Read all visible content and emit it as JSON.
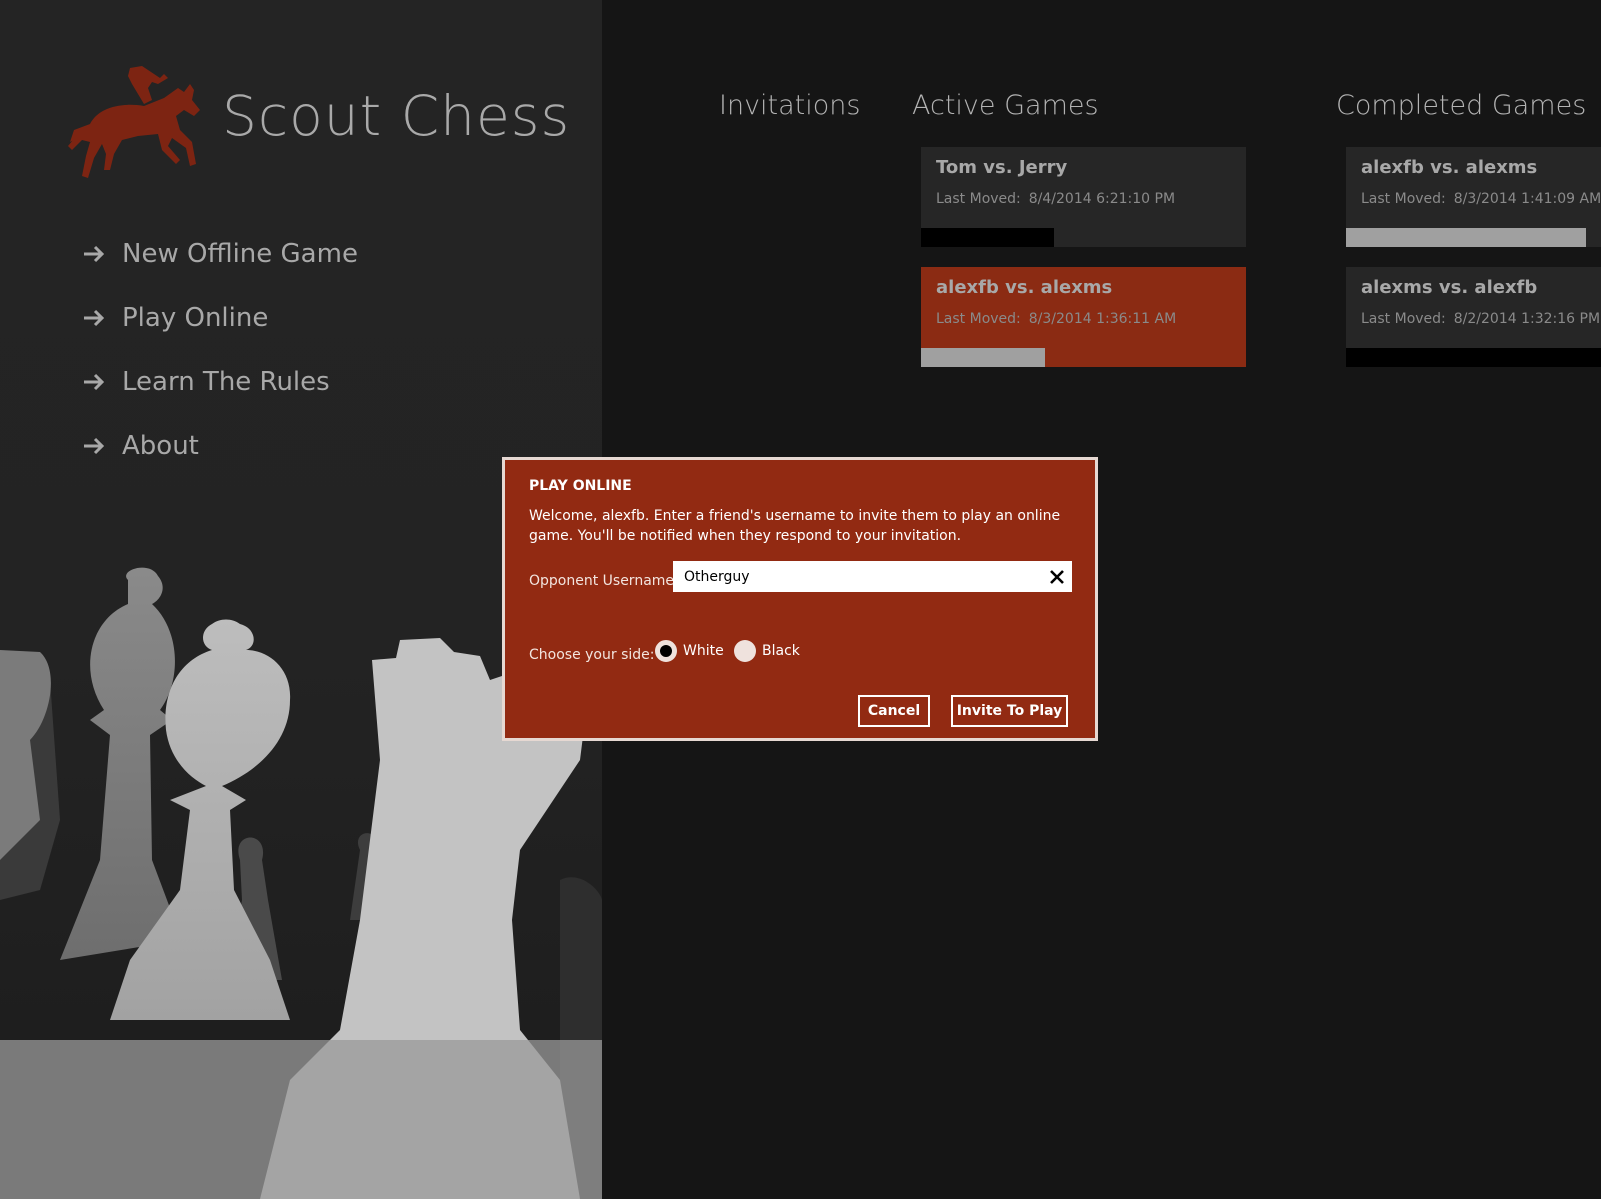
{
  "app": {
    "title": "Scout Chess"
  },
  "nav": [
    {
      "label": "New Offline Game"
    },
    {
      "label": "Play Online"
    },
    {
      "label": "Learn The Rules"
    },
    {
      "label": "About"
    }
  ],
  "columns": {
    "invitations": {
      "header": "Invitations"
    },
    "active": {
      "header": "Active Games",
      "games": [
        {
          "title": "Tom vs. Jerry",
          "last_moved_label": "Last Moved:",
          "last_moved": "8/4/2014 6:21:10 PM",
          "progress": 0.41,
          "bar_color": "#000000"
        },
        {
          "title": "alexfb vs. alexms",
          "last_moved_label": "Last Moved:",
          "last_moved": "8/3/2014 1:36:11 AM",
          "progress": 0.38,
          "bar_color": "#a0a0a0"
        }
      ]
    },
    "completed": {
      "header": "Completed Games",
      "games": [
        {
          "title": "alexfb vs. alexms",
          "last_moved_label": "Last Moved:",
          "last_moved": "8/3/2014 1:41:09 AM",
          "progress": 0.94,
          "bar_color": "#a0a0a0"
        },
        {
          "title": "alexms vs. alexfb",
          "last_moved_label": "Last Moved:",
          "last_moved": "8/2/2014 1:32:16 PM",
          "progress": 1.0,
          "bar_color": "#000000"
        }
      ]
    }
  },
  "dialog": {
    "title": "PLAY ONLINE",
    "message": "Welcome, alexfb. Enter a friend's username to invite them to play an online game. You'll be notified when they respond to your invitation.",
    "username_label": "Opponent Username",
    "username_value": "Otherguy",
    "side_label": "Choose your side:",
    "side_options": [
      "White",
      "Black"
    ],
    "selected_side": "White",
    "cancel_label": "Cancel",
    "invite_label": "Invite To Play"
  },
  "colors": {
    "accent": "#922a12",
    "selected_card": "#8b2b13",
    "logo": "#7d2412"
  },
  "icons": {
    "logo": "horse-rider-icon",
    "nav_arrow": "arrow-right-icon",
    "clear": "close-icon"
  }
}
